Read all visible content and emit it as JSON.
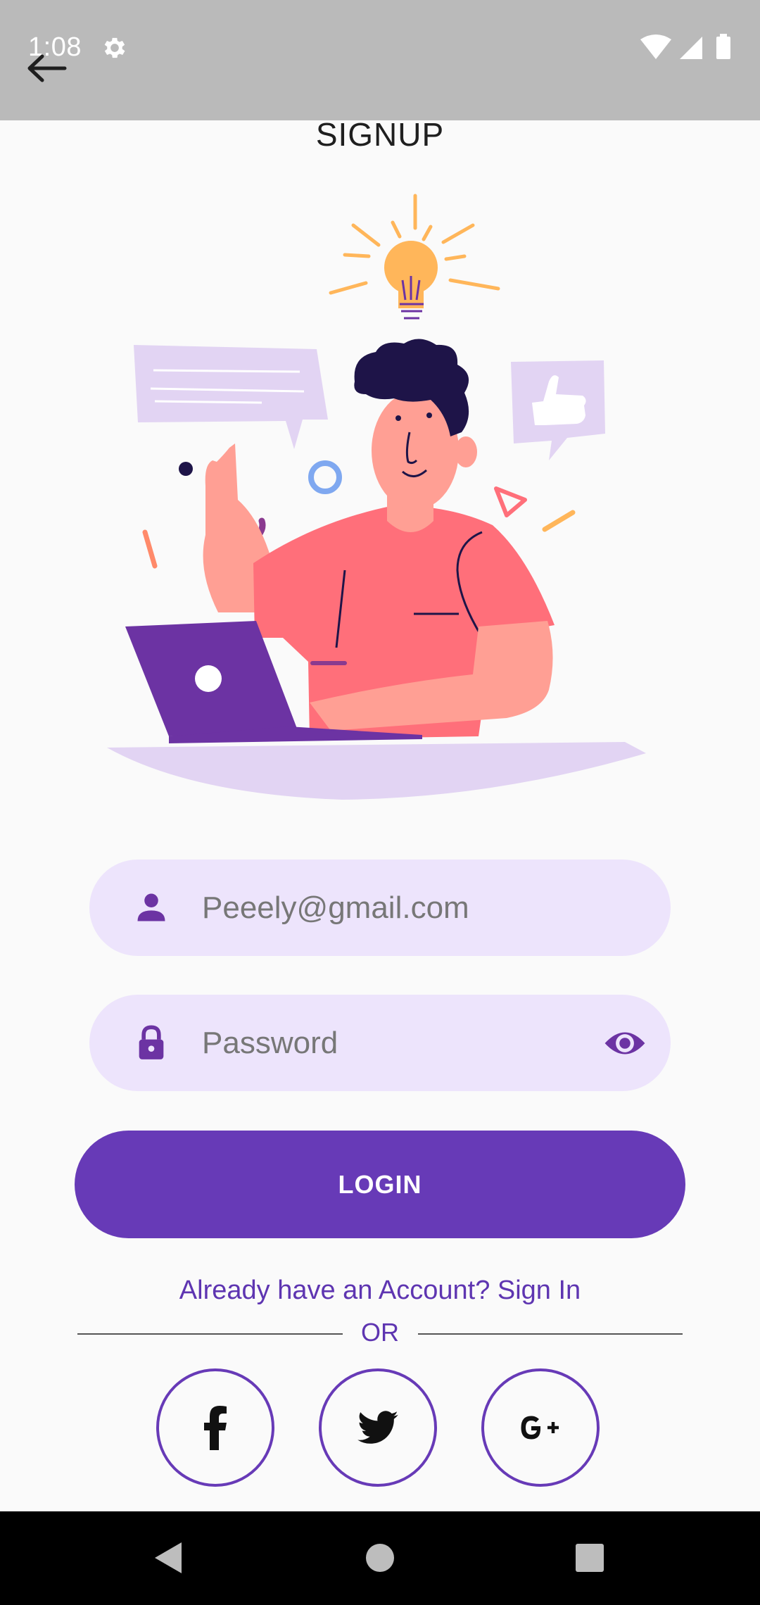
{
  "status_bar": {
    "time": "1:08",
    "icons": [
      "settings-icon",
      "wifi-icon",
      "signal-icon",
      "battery-icon"
    ]
  },
  "app_bar": {
    "back_icon": "arrow-left-icon",
    "title": "SIGNUP"
  },
  "form": {
    "email": {
      "icon": "person-icon",
      "value": "",
      "placeholder": "Peeely@gmail.com"
    },
    "password": {
      "icon": "lock-icon",
      "value": "",
      "placeholder": "Password",
      "toggle_icon": "eye-icon"
    },
    "submit_label": "LOGIN"
  },
  "signin_prompt": "Already have an Account? Sign In",
  "divider_label": "OR",
  "social": [
    {
      "name": "facebook",
      "icon": "facebook-icon",
      "label": "f"
    },
    {
      "name": "twitter",
      "icon": "twitter-icon"
    },
    {
      "name": "google",
      "icon": "google-plus-icon",
      "label": "G+"
    }
  ],
  "nav_bar": {
    "icons": [
      "nav-back-icon",
      "nav-home-icon",
      "nav-recents-icon"
    ]
  },
  "colors": {
    "accent": "#673ab7",
    "field_bg": "#ede4fc",
    "status_bar_bg": "#bababa",
    "page_bg": "#fafafa",
    "illustration_shirt": "#ff6f7a",
    "illustration_laptop": "#6c33a3",
    "illustration_lavender": "#e2d4f3",
    "illustration_bulb": "#ffb65a"
  }
}
